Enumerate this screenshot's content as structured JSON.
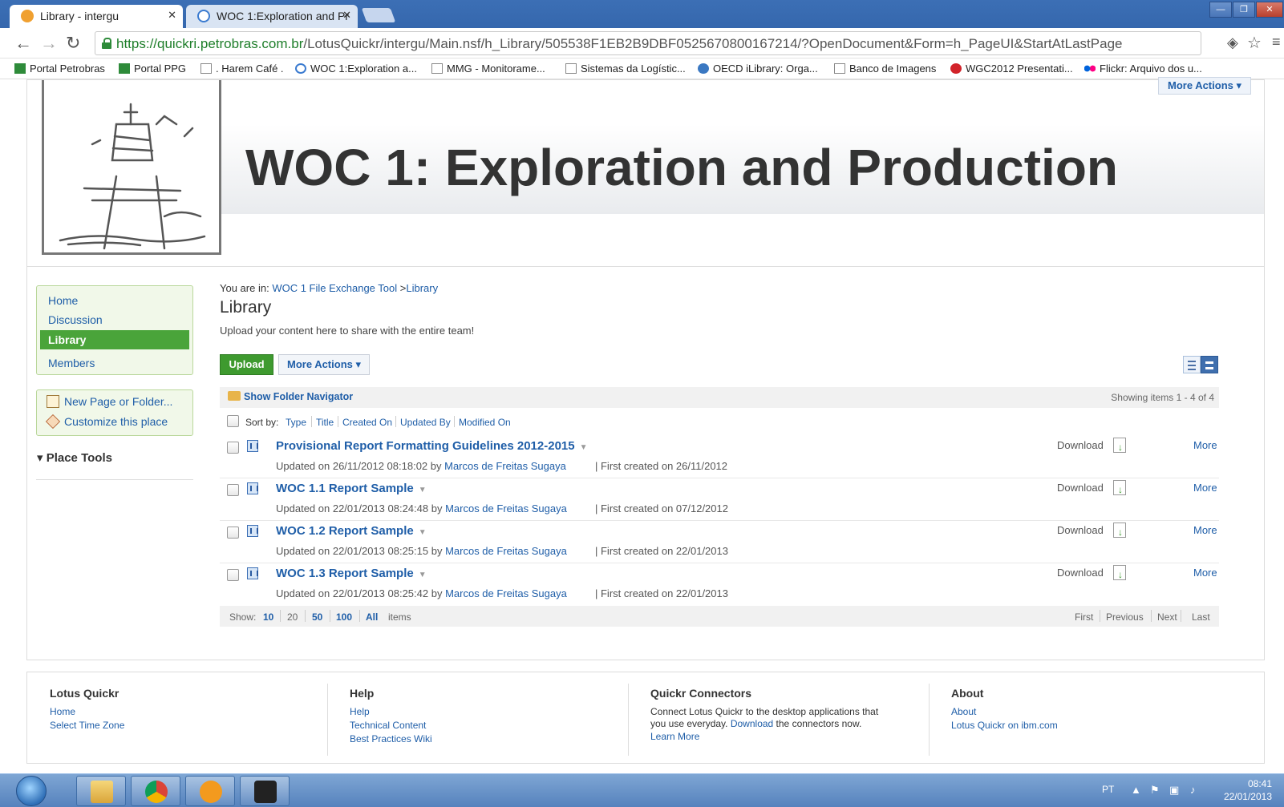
{
  "browser": {
    "tabs": [
      {
        "label": "Library - intergu",
        "active": true
      },
      {
        "label": "WOC 1:Exploration and Pr",
        "active": false
      }
    ],
    "url_host": "https://quickri.petrobras.com.br",
    "url_path": "/LotusQuickr/intergu/Main.nsf/h_Library/505538F1EB2B9DBF0525670800167214/?OpenDocument&Form=h_PageUI&StartAtLastPage",
    "bookmarks": [
      "Portal Petrobras",
      "Portal PPG",
      ". Harem Café .",
      "WOC 1:Exploration a...",
      "MMG - Monitorame...",
      "Sistemas da Logístic...",
      "OECD iLibrary: Orga...",
      "Banco de Imagens",
      "WGC2012 Presentati...",
      "Flickr: Arquivo dos u..."
    ]
  },
  "header": {
    "title": "WOC 1: Exploration and Production",
    "more_actions": "More Actions ▾"
  },
  "sidebar": {
    "nav": [
      "Home",
      "Discussion",
      "Library",
      "Members"
    ],
    "active": "Library",
    "actions": [
      "New Page or Folder...",
      "Customize this place"
    ],
    "place_tools": "▾ Place Tools"
  },
  "main": {
    "breadcrumb_prefix": "You are in:",
    "breadcrumb_link1": "WOC 1 File Exchange Tool",
    "breadcrumb_sep": " >",
    "breadcrumb_link2": "Library",
    "title": "Library",
    "description": "Upload your content here to share with the entire team!",
    "upload": "Upload",
    "more_actions": "More Actions ▾",
    "folder_nav": "Show Folder Navigator",
    "showing": "Showing items  1  -  4  of  4",
    "sort_label": "Sort by:",
    "sort_fields": [
      "Type",
      "Title",
      "Created On",
      "Updated By",
      "Modified On"
    ],
    "items": [
      {
        "title": "Provisional Report Formatting Guidelines 2012-2015",
        "updated": "Updated on 26/11/2012 08:18:02 by ",
        "author": "Marcos de Freitas Sugaya",
        "first": "| First created on 26/11/2012",
        "download": "Download",
        "more": "More"
      },
      {
        "title": "WOC 1.1 Report Sample",
        "updated": "Updated on 22/01/2013 08:24:48 by ",
        "author": "Marcos de Freitas Sugaya",
        "first": "| First created on 07/12/2012",
        "download": "Download",
        "more": "More"
      },
      {
        "title": "WOC 1.2 Report Sample",
        "updated": "Updated on 22/01/2013 08:25:15 by ",
        "author": "Marcos de Freitas Sugaya",
        "first": "| First created on 22/01/2013",
        "download": "Download",
        "more": "More"
      },
      {
        "title": "WOC 1.3 Report Sample",
        "updated": "Updated on 22/01/2013 08:25:42 by ",
        "author": "Marcos de Freitas Sugaya",
        "first": "| First created on 22/01/2013",
        "download": "Download",
        "more": "More"
      }
    ],
    "pager": {
      "show": "Show:",
      "sizes": [
        "10",
        "20",
        "50",
        "100",
        "All"
      ],
      "items": "items",
      "nav": [
        "First",
        "Previous",
        "Next",
        "Last"
      ]
    }
  },
  "footer": {
    "cols": [
      {
        "heading": "Lotus Quickr",
        "links": [
          "Home",
          "Select Time Zone"
        ]
      },
      {
        "heading": "Help",
        "links": [
          "Help",
          "Technical Content",
          "Best Practices Wiki"
        ]
      },
      {
        "heading": "Quickr Connectors",
        "text1": "Connect Lotus Quickr to the desktop applications that",
        "text2a": "you use everyday. ",
        "text2link": "Download",
        "text2b": " the connectors now.",
        "link": "Learn More"
      },
      {
        "heading": "About",
        "links": [
          "About",
          "Lotus Quickr on ibm.com"
        ]
      }
    ]
  },
  "taskbar": {
    "lang": "PT",
    "time": "08:41",
    "date": "22/01/2013"
  }
}
